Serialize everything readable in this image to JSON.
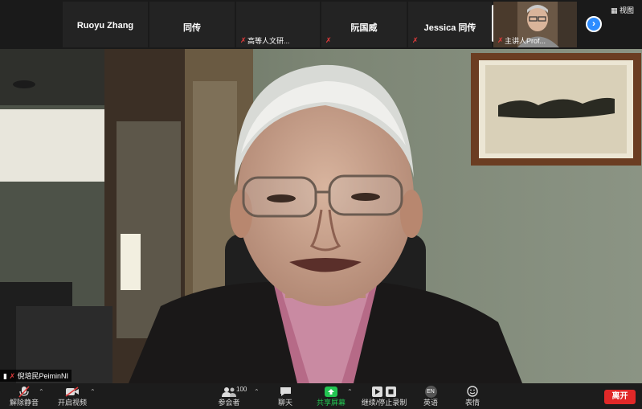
{
  "gallery": {
    "tiles": [
      {
        "name": "Ruoyu Zhang",
        "muted": false
      },
      {
        "name": "同传",
        "muted": false
      },
      {
        "name": "",
        "label": "高等人文研...",
        "muted": true
      },
      {
        "name": "阮国威",
        "muted": true
      },
      {
        "name": "Jessica 同传",
        "muted": true
      },
      {
        "name": "",
        "label": "主讲人Prof...",
        "muted": true
      }
    ],
    "view_label": "视图",
    "next_symbol": "›"
  },
  "main": {
    "speaker_name": "倪培民PeiminNI"
  },
  "toolbar": {
    "unmute": "解除静音",
    "start_video": "开启视频",
    "participants": "参会者",
    "participant_count": "100",
    "chat": "聊天",
    "share_screen": "共享屏幕",
    "record": "继续/停止录制",
    "language": "英语",
    "language_badge": "EN",
    "reactions": "表情",
    "leave": "离开"
  },
  "colors": {
    "accent": "#2d8cff",
    "leave": "#e02828",
    "share": "#23c552",
    "mute": "#e23b3b"
  }
}
